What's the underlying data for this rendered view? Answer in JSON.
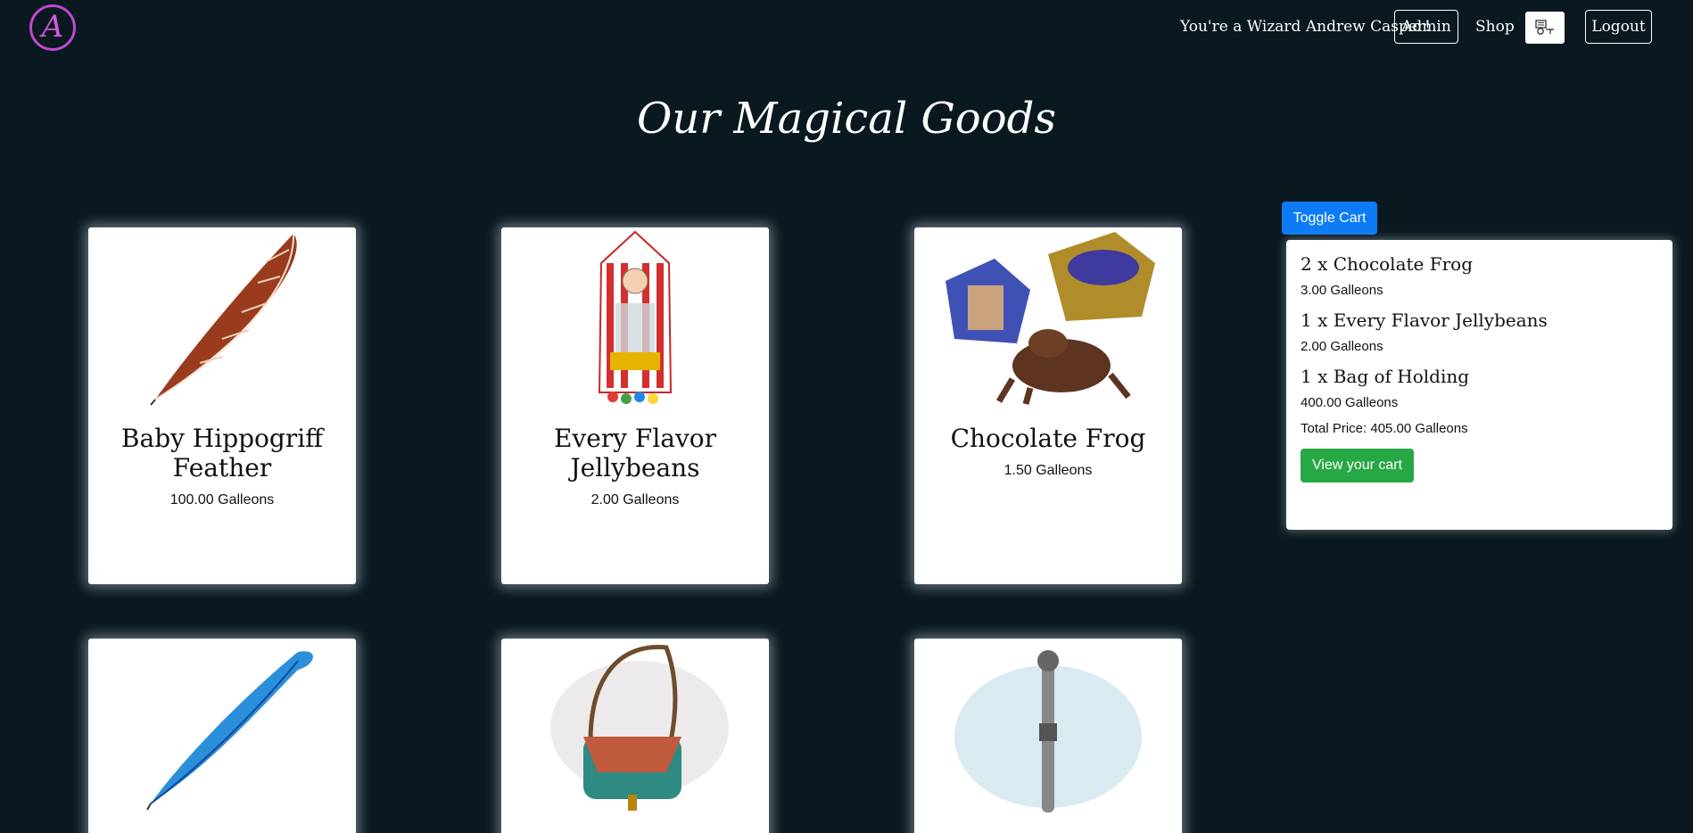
{
  "nav": {
    "logo_letter": "A",
    "greeting": "You're a Wizard Andrew Casper!",
    "admin_label": "Admin",
    "shop_label": "Shop",
    "cart_icon": "cart-icon",
    "logout_label": "Logout"
  },
  "page_title": "Our Magical Goods",
  "products": [
    {
      "name": "Baby Hippogriff Feather",
      "price": "100.00 Galleons",
      "image": "feather-brown"
    },
    {
      "name": "Every Flavor Jellybeans",
      "price": "2.00 Galleons",
      "image": "jellybean-box"
    },
    {
      "name": "Chocolate Frog",
      "price": "1.50 Galleons",
      "image": "chocolate-frog"
    },
    {
      "name": "",
      "price": "",
      "image": "feather-blue"
    },
    {
      "name": "",
      "price": "",
      "image": "bag"
    },
    {
      "name": "",
      "price": "",
      "image": "wand"
    }
  ],
  "cart": {
    "toggle_label": "Toggle Cart",
    "items": [
      {
        "name": "2 x Chocolate Frog",
        "price": "3.00 Galleons"
      },
      {
        "name": "1 x Every Flavor Jellybeans",
        "price": "2.00 Galleons"
      },
      {
        "name": "1 x Bag of Holding",
        "price": "400.00 Galleons"
      }
    ],
    "total": "Total Price: 405.00 Galleons",
    "view_label": "View your cart"
  },
  "colors": {
    "background": "#0a1820",
    "toggle_button": "#0d7bf6",
    "view_cart_button": "#28a745",
    "logo": "#c048d0"
  }
}
